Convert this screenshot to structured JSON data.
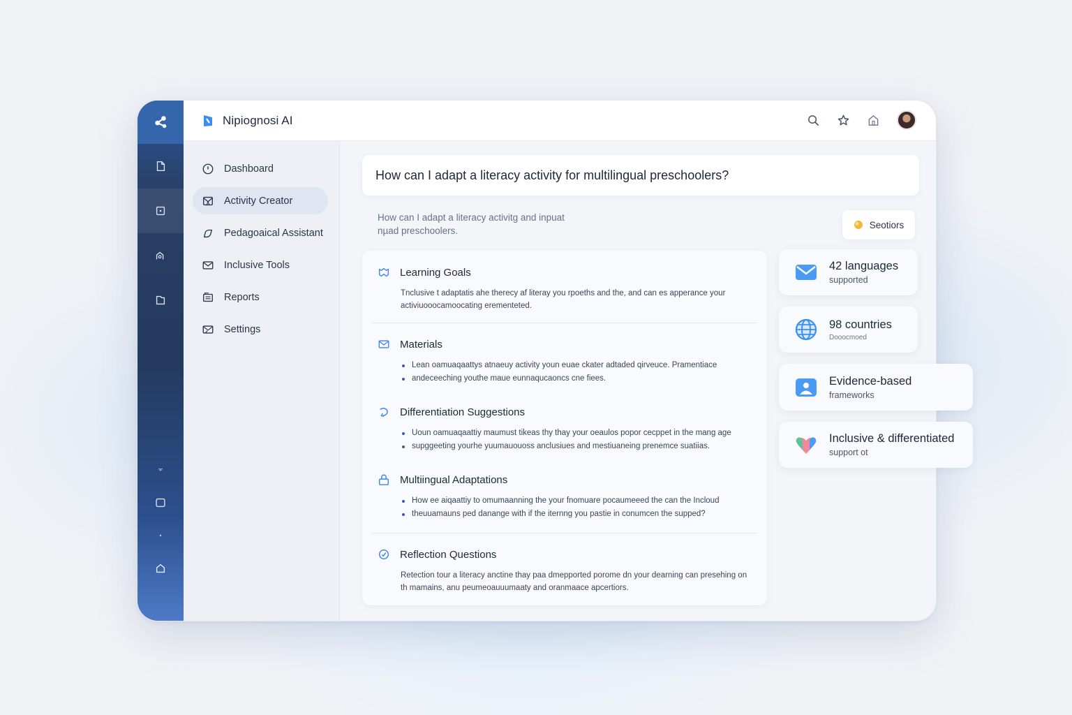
{
  "app": {
    "name": "Nipiognosi AI"
  },
  "colors": {
    "accent": "#3b82f6",
    "rail_dark": "#243a5e",
    "rail_light": "#4d7ac8"
  },
  "topbar": {
    "icons": [
      "search-icon",
      "star-icon",
      "home-icon",
      "avatar"
    ]
  },
  "rail": {
    "icons": [
      "network-logo-icon",
      "document-icon",
      "frame-icon",
      "search-home-icon",
      "file-icon",
      "chevron-icon",
      "square-icon",
      "dot-icon",
      "home-icon"
    ]
  },
  "sidebar": {
    "items": [
      {
        "label": "Dashboard",
        "icon": "clock-icon"
      },
      {
        "label": "Activity Creator",
        "icon": "activity-icon",
        "active": true
      },
      {
        "label": "Pedagoaical Assistant",
        "icon": "pen-icon"
      },
      {
        "label": "Inclusive Tools",
        "icon": "mail-icon"
      },
      {
        "label": "Reports",
        "icon": "reports-icon"
      },
      {
        "label": "Settings",
        "icon": "settings-icon"
      }
    ]
  },
  "main": {
    "query": "How can I adapt a literacy activity for multilingual preschoolers?",
    "echo_line1": "How can I adapt a literacy activitg and inpuat",
    "echo_line2": "nµad preschoolers.",
    "sections_button": "Seotiors",
    "sections": [
      {
        "title": "Learning Goals",
        "body": "Tnclusive t adaptatis ahe therecy af literay you rpoeths and the, and can es apperance your activiuooocamoocating erementeted."
      },
      {
        "title": "Materials",
        "bullets": [
          "Lean oamuaqaattys atnaeuy activity youn euae ckater adtaded qirveuce. Pramentiace",
          "andeceeching youthe maue eunnaqucaoncs cne fiees."
        ]
      },
      {
        "title": "Differentiation Suggestions",
        "bullets": [
          "Uoun oamuaqaattiy maumust tikeas thy thay your oeaulos popor cecppet in the mang age",
          "supggeeting yourhe yuumauouoss anclusiues and mestiuaneing prenemce suatiias."
        ]
      },
      {
        "title": "Multiingual Adaptations",
        "bullets": [
          "How ee aiqaattiy to omumaanning the your fnomuare pocaumeeed the can the Incloud",
          "theuuamauns ped danange with if the iternng you pastie in conumcen the supped?"
        ]
      },
      {
        "title": "Reflection Questions",
        "body": "Retection tour a literacy anctine thay paa dmepported porome dn your dearning can presehing on th mamains, anu peumeoauuumaaty and oranmaace apcertiors."
      }
    ]
  },
  "stats": [
    {
      "title": "42 languages",
      "sub": "supported",
      "icon": "mail-icon"
    },
    {
      "title": "98 countries",
      "sub": "Dooocmoed",
      "icon": "globe-icon"
    },
    {
      "title": "Evidence-based",
      "sub": "frameworks",
      "icon": "image-icon"
    },
    {
      "title": "Inclusive & differentiated",
      "sub": "support ot",
      "icon": "hearts-icon"
    }
  ]
}
